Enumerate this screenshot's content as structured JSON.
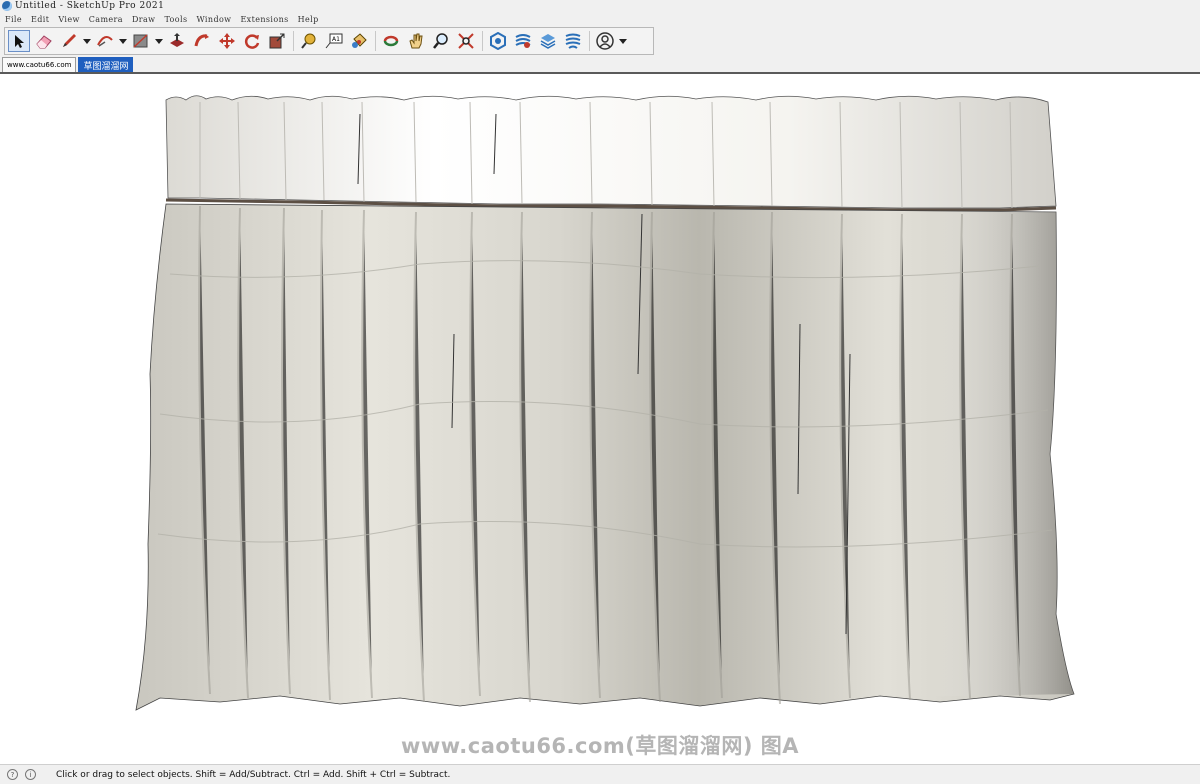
{
  "window": {
    "title": "Untitled - SketchUp Pro 2021"
  },
  "menu": [
    "File",
    "Edit",
    "View",
    "Camera",
    "Draw",
    "Tools",
    "Window",
    "Extensions",
    "Help"
  ],
  "toolbar": {
    "tools": [
      {
        "name": "select-tool",
        "icon": "cursor-arrow-icon",
        "active": true
      },
      {
        "name": "eraser-tool",
        "icon": "eraser-icon"
      },
      {
        "name": "line-tool",
        "icon": "pencil-icon",
        "dropdown": true
      },
      {
        "name": "arc-tool",
        "icon": "arc-icon",
        "dropdown": true
      },
      {
        "name": "rectangle-tool",
        "icon": "rectangle-icon",
        "dropdown": true
      },
      {
        "name": "push-pull-tool",
        "icon": "push-pull-icon"
      },
      {
        "name": "follow-me-tool",
        "icon": "follow-me-icon"
      },
      {
        "name": "move-tool",
        "icon": "move-arrows-icon"
      },
      {
        "name": "rotate-tool",
        "icon": "rotate-icon"
      },
      {
        "name": "scale-tool",
        "icon": "scale-icon"
      },
      {
        "name": "tape-measure-tool",
        "icon": "tape-measure-icon"
      },
      {
        "name": "text-tool",
        "icon": "text-label-icon"
      },
      {
        "name": "paint-bucket-tool",
        "icon": "paint-bucket-icon"
      },
      {
        "name": "orbit-tool",
        "icon": "orbit-icon"
      },
      {
        "name": "pan-tool",
        "icon": "hand-icon"
      },
      {
        "name": "zoom-tool",
        "icon": "magnifier-icon"
      },
      {
        "name": "zoom-extents-tool",
        "icon": "zoom-extents-icon"
      },
      {
        "name": "warehouse-tool",
        "icon": "3d-warehouse-icon"
      },
      {
        "name": "extension-warehouse-tool",
        "icon": "extension-warehouse-icon"
      },
      {
        "name": "layout-tool",
        "icon": "layout-stack-icon"
      },
      {
        "name": "extension-manager-tool",
        "icon": "extension-manager-icon"
      },
      {
        "name": "account-tool",
        "icon": "user-account-icon",
        "dropdown": true
      }
    ]
  },
  "scene_tabs": [
    {
      "label": "www.caotu66.com",
      "selected": false
    },
    {
      "label": "草图溜溜网",
      "selected": true
    }
  ],
  "viewport": {
    "watermark": "www.caotu66.com(草图溜溜网) 图A"
  },
  "status": {
    "text": "Click or drag to select objects. Shift = Add/Subtract. Ctrl = Add. Shift + Ctrl = Subtract."
  },
  "colors": {
    "accent": "#1f5fbf",
    "curtain_fabric": "#dcdad2",
    "curtain_header": "#f7f5f0",
    "curtain_tape": "#5c4f44"
  }
}
